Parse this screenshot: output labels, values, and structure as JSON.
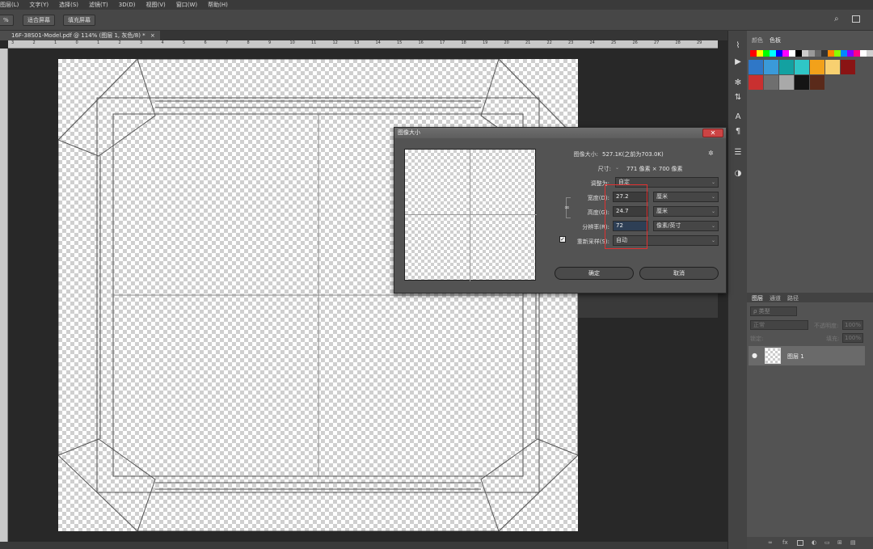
{
  "menubar": {
    "items": [
      "图层(L)",
      "文字(Y)",
      "选择(S)",
      "滤镜(T)",
      "3D(D)",
      "视图(V)",
      "窗口(W)",
      "帮助(H)"
    ]
  },
  "options": {
    "zoom": "%",
    "fit_screen": "适合屏幕",
    "fill_screen": "填充屏幕"
  },
  "document": {
    "tab_title": "16F-38S01-Model.pdf @ 114% (图层 1, 灰色/8) *",
    "close": "×"
  },
  "ruler": {
    "ticks": [
      "3",
      "2",
      "1",
      "0",
      "1",
      "2",
      "3",
      "4",
      "5",
      "6",
      "7",
      "8",
      "9",
      "10",
      "11",
      "12",
      "13",
      "14",
      "15",
      "16",
      "17",
      "18",
      "19",
      "20",
      "21",
      "22",
      "23",
      "24",
      "25",
      "26",
      "27",
      "28",
      "29"
    ]
  },
  "tools": {
    "icons": [
      "brush-mix-icon",
      "play-icon",
      "gear-brush-icon",
      "adjust-tool-icon",
      "text-a-icon",
      "paragraph-icon",
      "properties-icon",
      "color-wheel-icon"
    ]
  },
  "right_panel": {
    "tabs": [
      "颜色",
      "色板"
    ],
    "swatch_colors_small": [
      "#ff0000",
      "#ffff00",
      "#00ff00",
      "#00ffff",
      "#0000ff",
      "#ff00ff",
      "#ffffff",
      "#000000",
      "#cccccc",
      "#999999",
      "#666666",
      "#333333",
      "#ff8800",
      "#88ff00",
      "#0088ff",
      "#8800ff",
      "#ff0088",
      "#ffffff",
      "#d0d0d0"
    ],
    "swatch_colors": [
      "#2f77c7",
      "#3a9ad9",
      "#13a1a1",
      "#2fc6c6",
      "#f2a11a",
      "#f8d070",
      "#8a1414",
      "#c93030",
      "#6f6f6f",
      "#a9a9a9",
      "#141414",
      "#5a2a1a"
    ],
    "layers_tabs": [
      "图层",
      "通道",
      "路径"
    ],
    "layer_kind": "ρ 类型",
    "blend_mode": "正常",
    "opacity_label": "不透明度:",
    "opacity_value": "100%",
    "lock_label": "锁定:",
    "fill_label": "填充:",
    "fill_value": "100%",
    "layer_name": "图层 1",
    "bottom_icons": [
      "link-icon",
      "fx-icon",
      "mask-icon",
      "adjustment-icon",
      "folder-icon",
      "new-layer-icon",
      "trash-icon"
    ]
  },
  "dialog": {
    "title": "图像大小",
    "image_size_label": "图像大小:",
    "image_size_value": "527.1K(之前为703.0K)",
    "dimension_label": "尺寸:",
    "dimension_value": "771 像素 × 700 像素",
    "fit_label": "调整为:",
    "fit_value": "自定",
    "width_label": "宽度(D):",
    "width_value": "27.2",
    "width_unit": "厘米",
    "height_label": "高度(G):",
    "height_value": "24.7",
    "height_unit": "厘米",
    "resolution_label": "分辨率(R):",
    "resolution_value": "72",
    "resolution_unit": "像素/英寸",
    "resample_label": "重新采样(S):",
    "resample_value": "自动",
    "ok": "确定",
    "cancel": "取消"
  }
}
